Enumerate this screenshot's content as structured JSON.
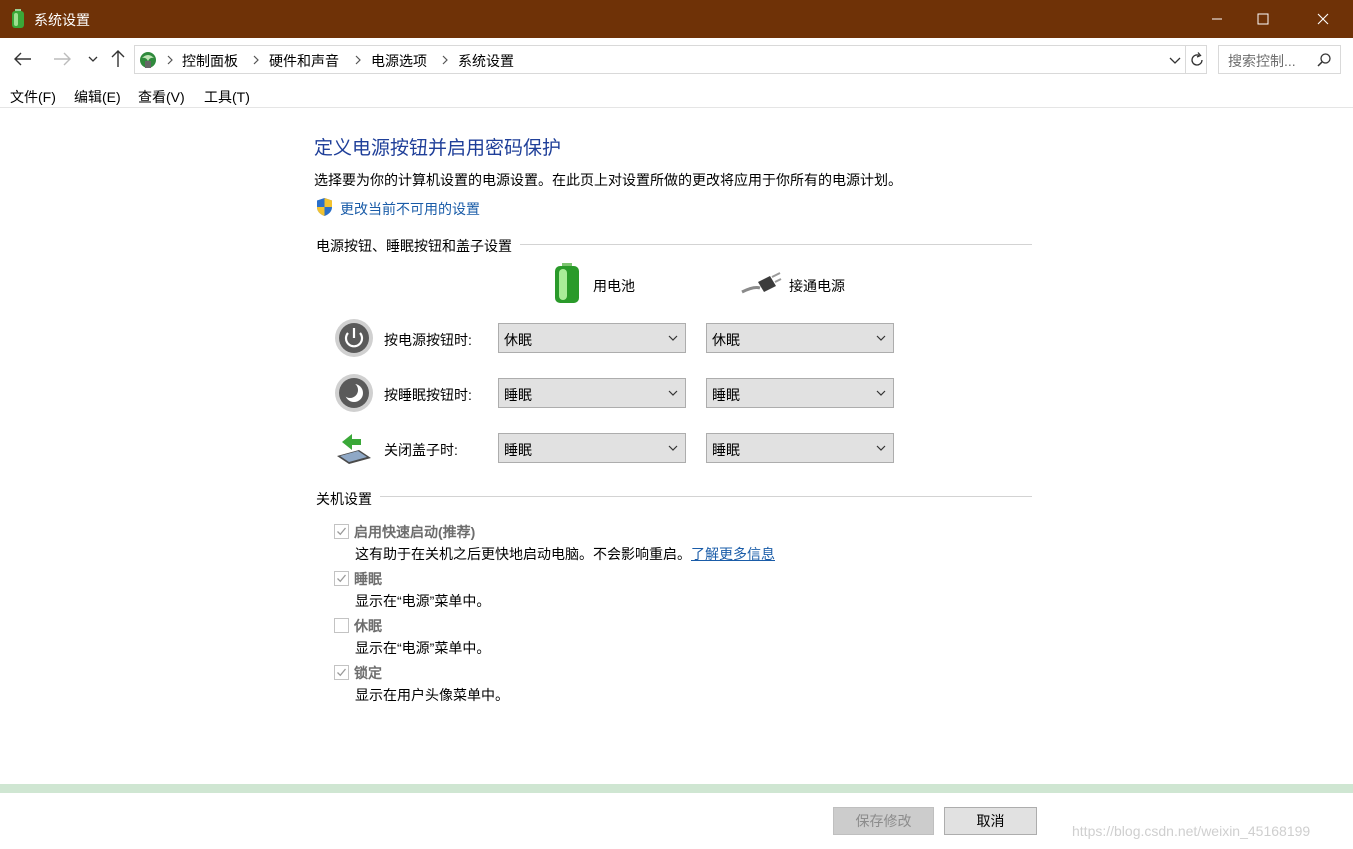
{
  "window": {
    "title": "系统设置",
    "minimize_icon": "minimize-icon",
    "maximize_icon": "maximize-icon",
    "close_icon": "close-icon"
  },
  "nav": {
    "breadcrumbs": [
      "控制面板",
      "硬件和声音",
      "电源选项",
      "系统设置"
    ],
    "search_placeholder": "搜索控制..."
  },
  "menu": [
    "文件(F)",
    "编辑(E)",
    "查看(V)",
    "工具(T)"
  ],
  "main": {
    "title": "定义电源按钮并启用密码保护",
    "description": "选择要为你的计算机设置的电源设置。在此页上对设置所做的更改将应用于你所有的电源计划。",
    "change_link": "更改当前不可用的设置",
    "buttons_section": {
      "heading": "电源按钮、睡眠按钮和盖子设置",
      "col_battery": "用电池",
      "col_plugged": "接通电源",
      "rows": [
        {
          "label": "按电源按钮时:",
          "battery": "休眠",
          "plugged": "休眠",
          "icon": "power-button-icon"
        },
        {
          "label": "按睡眠按钮时:",
          "battery": "睡眠",
          "plugged": "睡眠",
          "icon": "sleep-button-icon"
        },
        {
          "label": "关闭盖子时:",
          "battery": "睡眠",
          "plugged": "睡眠",
          "icon": "lid-close-icon"
        }
      ]
    },
    "shutdown_section": {
      "heading": "关机设置",
      "items": [
        {
          "title": "启用快速启动(推荐)",
          "checked": true,
          "desc": "这有助于在关机之后更快地启动电脑。不会影响重启。",
          "link": "了解更多信息"
        },
        {
          "title": "睡眠",
          "checked": true,
          "desc": "显示在“电源”菜单中。"
        },
        {
          "title": "休眠",
          "checked": false,
          "desc": "显示在“电源”菜单中。"
        },
        {
          "title": "锁定",
          "checked": true,
          "desc": "显示在用户头像菜单中。"
        }
      ]
    }
  },
  "footer": {
    "save_label": "保存修改",
    "cancel_label": "取消",
    "watermark": "https://blog.csdn.net/weixin_45168199"
  },
  "colors": {
    "titlebar": "#6f3207",
    "link": "#1a5ca8",
    "heading": "#1f3f99",
    "footer_band": "#cfe6d2"
  }
}
